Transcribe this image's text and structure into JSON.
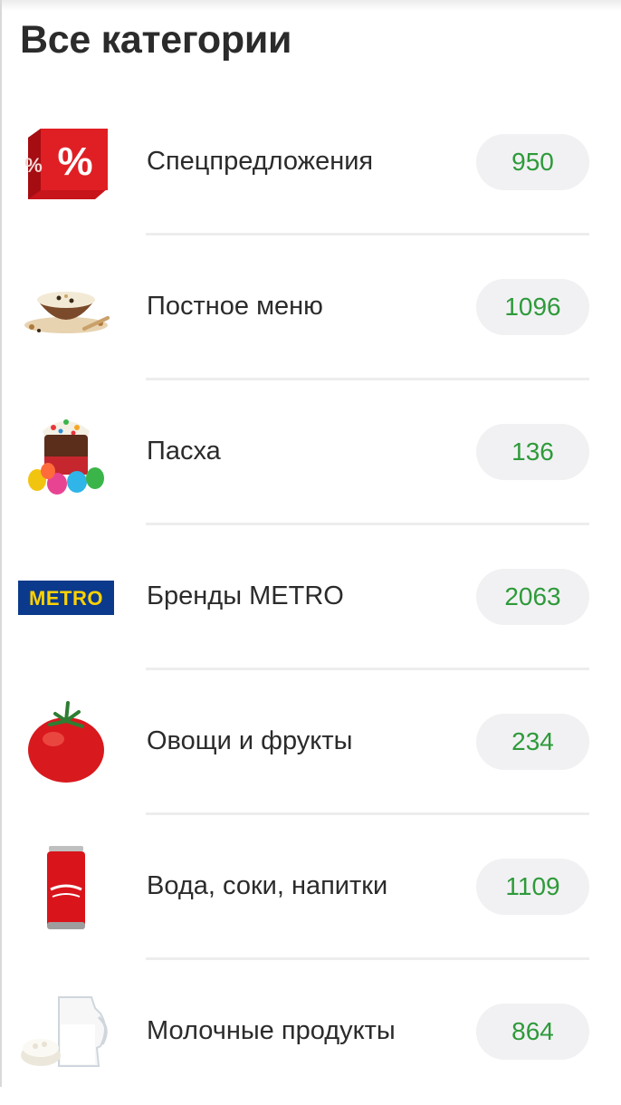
{
  "page": {
    "title": "Все категории"
  },
  "categories": [
    {
      "label": "Спецпредложения",
      "count": "950",
      "icon": "discount-cube-icon"
    },
    {
      "label": "Постное меню",
      "count": "1096",
      "icon": "porridge-bowl-icon"
    },
    {
      "label": "Пасха",
      "count": "136",
      "icon": "easter-cake-icon"
    },
    {
      "label": "Бренды METRO",
      "count": "2063",
      "icon": "metro-logo-icon",
      "logo_text": "METRO"
    },
    {
      "label": "Овощи и фрукты",
      "count": "234",
      "icon": "tomato-icon"
    },
    {
      "label": "Вода, соки, напитки",
      "count": "1109",
      "icon": "cola-can-icon"
    },
    {
      "label": "Молочные продукты",
      "count": "864",
      "icon": "milk-jug-icon"
    }
  ],
  "colors": {
    "accent_green": "#2e9a3a",
    "badge_bg": "#f1f1f3",
    "divider": "#ededed",
    "text": "#2b2b2b",
    "metro_blue": "#0b3a8c",
    "metro_yellow": "#ffd200"
  }
}
